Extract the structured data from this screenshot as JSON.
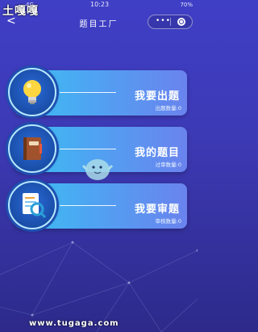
{
  "status": {
    "carrier": "",
    "signal": "4G",
    "time": "10:23",
    "battery": "70%"
  },
  "watermark": {
    "text": "土嘎嘎"
  },
  "nav": {
    "back": "<",
    "title": "题目工厂",
    "menu_dots": "•••"
  },
  "cards": [
    {
      "title": "我要出题",
      "subtitle": "出题数量:0",
      "icon": "lightbulb-icon"
    },
    {
      "title": "我的题目",
      "subtitle": "过审数量:0",
      "icon": "notebook-icon"
    },
    {
      "title": "我要审题",
      "subtitle": "审核数量:0",
      "icon": "document-search-icon"
    }
  ],
  "footer": {
    "site": "www.tugaga.com"
  }
}
